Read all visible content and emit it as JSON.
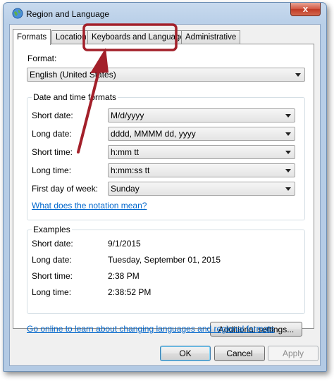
{
  "window": {
    "title": "Region and Language",
    "close_label": "x"
  },
  "tabs": [
    {
      "label": "Formats"
    },
    {
      "label": "Location"
    },
    {
      "label": "Keyboards and Languages"
    },
    {
      "label": "Administrative"
    }
  ],
  "format": {
    "label": "Format:",
    "value": "English (United States)"
  },
  "datetime": {
    "group_title": "Date and time formats",
    "rows": [
      {
        "label": "Short date:",
        "value": "M/d/yyyy"
      },
      {
        "label": "Long date:",
        "value": "dddd, MMMM dd, yyyy"
      },
      {
        "label": "Short time:",
        "value": "h:mm tt"
      },
      {
        "label": "Long time:",
        "value": "h:mm:ss tt"
      },
      {
        "label": "First day of week:",
        "value": "Sunday"
      }
    ],
    "notation_link": "What does the notation mean?"
  },
  "examples": {
    "group_title": "Examples",
    "rows": [
      {
        "label": "Short date:",
        "value": "9/1/2015"
      },
      {
        "label": "Long date:",
        "value": "Tuesday, September 01, 2015"
      },
      {
        "label": "Short time:",
        "value": "2:38 PM"
      },
      {
        "label": "Long time:",
        "value": "2:38:52 PM"
      }
    ]
  },
  "additional_settings_label": "Additional settings...",
  "online_link": "Go online to learn about changing languages and regional formats",
  "buttons": {
    "ok": "OK",
    "cancel": "Cancel",
    "apply": "Apply"
  },
  "colors": {
    "annotation": "#a3202a",
    "link": "#0066cc"
  }
}
